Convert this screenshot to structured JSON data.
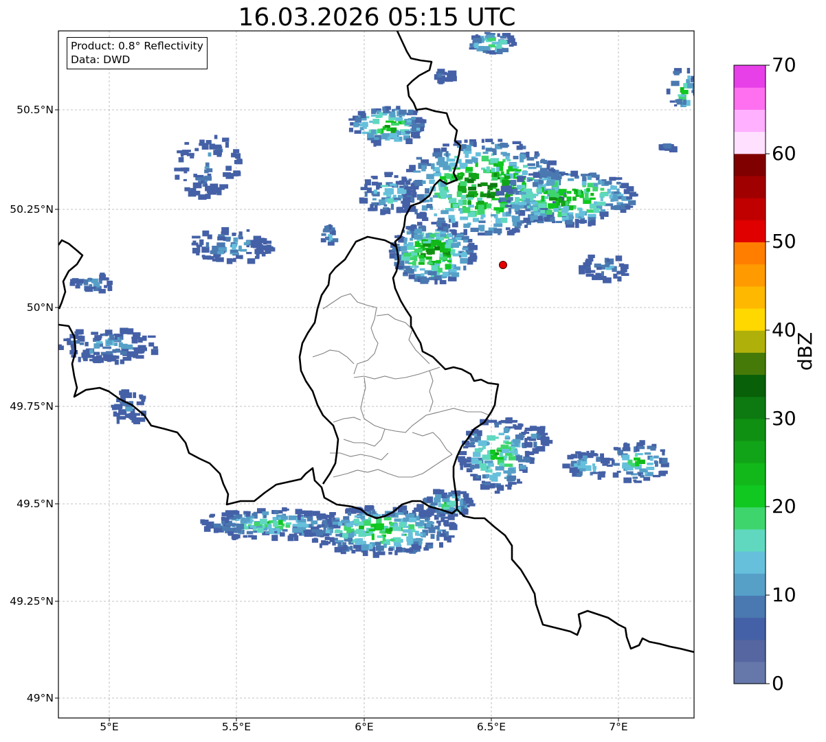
{
  "title": "16.03.2026 05:15 UTC",
  "info": {
    "product": "Product: 0.8° Reflectivity",
    "data": "Data: DWD"
  },
  "lat_labels": [
    "49°N",
    "49.25°N",
    "49.5°N",
    "49.75°N",
    "50°N",
    "50.25°N",
    "50.5°N"
  ],
  "lon_labels": [
    "5°E",
    "5.5°E",
    "6°E",
    "6.5°E",
    "7°E"
  ],
  "map": {
    "lon_range": [
      4.8,
      7.3
    ],
    "lat_range": [
      48.95,
      50.7
    ],
    "grid": true,
    "marker": {
      "lon": 6.54,
      "lat": 50.11,
      "color": "#e60000"
    }
  },
  "colorbar": {
    "title": "dBZ",
    "min": 0,
    "max": 70,
    "ticks": [
      "0",
      "10",
      "20",
      "30",
      "40",
      "50",
      "60",
      "70"
    ],
    "colors": [
      "#6677aa",
      "#5566a0",
      "#4460a6",
      "#4a78b0",
      "#56a0c8",
      "#66c0dc",
      "#60d8c0",
      "#3ed66c",
      "#10c820",
      "#12b81a",
      "#12a418",
      "#109012",
      "#0c7a10",
      "#086008",
      "#467a08",
      "#b0b00a",
      "#ffd800",
      "#ffb800",
      "#ff9a00",
      "#ff7e00",
      "#e00000",
      "#c00000",
      "#a00000",
      "#800000",
      "#ffe0ff",
      "#ffb0ff",
      "#ff70f0",
      "#e840e8"
    ]
  }
}
